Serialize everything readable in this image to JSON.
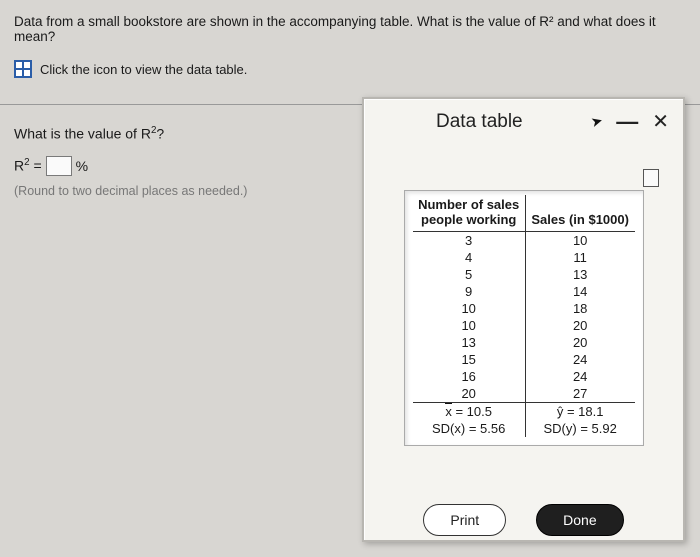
{
  "question": "Data from a small bookstore are shown in the accompanying table. What is the value of R² and what does it mean?",
  "icon_hint": "Click the icon to view the data table.",
  "left": {
    "sub_question": "What is the value of R²?",
    "eq_lhs": "R² =",
    "eq_rhs": "%",
    "hint": "(Round to two decimal places as needed.)"
  },
  "modal": {
    "title": "Data table",
    "header_left_1": "Number of sales",
    "header_left_2": "people working",
    "header_right": "Sales (in $1000)",
    "rows": [
      {
        "x": "3",
        "y": "10"
      },
      {
        "x": "4",
        "y": "11"
      },
      {
        "x": "5",
        "y": "13"
      },
      {
        "x": "9",
        "y": "14"
      },
      {
        "x": "10",
        "y": "18"
      },
      {
        "x": "10",
        "y": "20"
      },
      {
        "x": "13",
        "y": "20"
      },
      {
        "x": "15",
        "y": "24"
      },
      {
        "x": "16",
        "y": "24"
      },
      {
        "x": "20",
        "y": "27"
      }
    ],
    "stats_x_mean": "x̄ = 10.5",
    "stats_y_mean": "ȳ = 18.1",
    "stats_x_sd": "SD(x) = 5.56",
    "stats_y_sd": "SD(y) = 5.92",
    "print": "Print",
    "done": "Done"
  }
}
